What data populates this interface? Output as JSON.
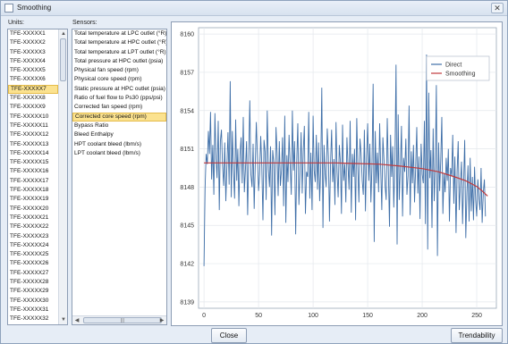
{
  "window": {
    "title": "Smoothing",
    "close_glyph": "✕"
  },
  "units": {
    "label": "Units:",
    "items": [
      "TFE-XXXXX1",
      "TFE-XXXXX2",
      "TFE-XXXXX3",
      "TFE-XXXXX4",
      "TFE-XXXXX5",
      "TFE-XXXXX6",
      "TFE-XXXXX7",
      "TFE-XXXXX8",
      "TFE-XXXXX9",
      "TFE-XXXXX10",
      "TFE-XXXXX11",
      "TFE-XXXXX12",
      "TFE-XXXXX13",
      "TFE-XXXXX14",
      "TFE-XXXXX15",
      "TFE-XXXXX16",
      "TFE-XXXXX17",
      "TFE-XXXXX18",
      "TFE-XXXXX19",
      "TFE-XXXXX20",
      "TFE-XXXXX21",
      "TFE-XXXXX22",
      "TFE-XXXXX23",
      "TFE-XXXXX24",
      "TFE-XXXXX25",
      "TFE-XXXXX26",
      "TFE-XXXXX27",
      "TFE-XXXXX28",
      "TFE-XXXXX29",
      "TFE-XXXXX30",
      "TFE-XXXXX31",
      "TFE-XXXXX32"
    ],
    "selected_index": 6
  },
  "sensors": {
    "label": "Sensors:",
    "items": [
      "Total temperature at LPC outlet (°R)",
      "Total temperature at HPC outlet (°R)",
      "Total temperature at LPT outlet (°R)",
      "Total pressure at HPC outlet (psia)",
      "Physical fan speed (rpm)",
      "Physical core speed (rpm)",
      "Static pressure at HPC outlet (psia)",
      "Ratio of fuel flow to Ps30 (pps/psi)",
      "Corrected fan speed (rpm)",
      "Corrected core speed (rpm)",
      "Bypass Ratio",
      "Bleed Enthalpy",
      "HPT coolant bleed (lbm/s)",
      "LPT coolant bleed (lbm/s)"
    ],
    "selected_index": 9
  },
  "buttons": {
    "close": "Close",
    "trendability": "Trendability"
  },
  "chart_data": {
    "type": "line",
    "xlim": [
      -5,
      268
    ],
    "ylim": [
      8138.5,
      8160.5
    ],
    "xticks": [
      0,
      50,
      100,
      150,
      200,
      250
    ],
    "yticks": [
      8139,
      8142,
      8145,
      8148,
      8151,
      8154,
      8157,
      8160
    ],
    "grid": true,
    "legend_position": "top-right",
    "series": [
      {
        "name": "Direct",
        "color": "#3f6fa8",
        "x_start": 0,
        "x_step": 1,
        "values": [
          8141.8,
          8147.9,
          8150.6,
          8149.8,
          8152.4,
          8150.6,
          8153.9,
          8148.6,
          8151.3,
          8147.4,
          8153.8,
          8150.3,
          8148.7,
          8153.2,
          8146.2,
          8151.6,
          8152.5,
          8149.7,
          8148.1,
          8151.5,
          8146.9,
          8149.6,
          8152.3,
          8148.2,
          8156.3,
          8147.2,
          8152.4,
          8149.4,
          8147.1,
          8153.3,
          8148.5,
          8151.0,
          8146.5,
          8150.6,
          8151.9,
          8148.3,
          8153.5,
          8147.6,
          8149.5,
          8151.6,
          8145.8,
          8150.4,
          8154.8,
          8149.0,
          8148.0,
          8151.4,
          8146.3,
          8149.8,
          8153.1,
          8150.2,
          8147.7,
          8149.0,
          8152.0,
          8149.7,
          8145.4,
          8151.7,
          8150.8,
          8147.0,
          8154.0,
          8149.4,
          8148.0,
          8151.2,
          8144.2,
          8150.9,
          8149.9,
          8145.8,
          8152.7,
          8150.7,
          8147.3,
          8151.6,
          8148.1,
          8149.3,
          8151.9,
          8146.5,
          8153.6,
          8145.2,
          8150.5,
          8148.4,
          8152.1,
          8149.6,
          8147.4,
          8154.0,
          8149.3,
          8151.6,
          8144.3,
          8150.1,
          8153.0,
          8146.6,
          8149.1,
          8152.3,
          8147.5,
          8150.8,
          8152.8,
          8145.9,
          8149.2,
          8148.8,
          8153.9,
          8147.1,
          8150.7,
          8146.2,
          8153.6,
          8149.3,
          8148.4,
          8152.1,
          8147.8,
          8151.5,
          8146.9,
          8149.5,
          8155.8,
          8144.8,
          8151.3,
          8149.1,
          8148.0,
          8152.6,
          8150.4,
          8145.3,
          8149.9,
          8152.5,
          8148.4,
          8150.2,
          8146.6,
          8153.1,
          8149.2,
          8147.2,
          8151.3,
          8150.0,
          8145.9,
          8152.9,
          8148.5,
          8149.8,
          8146.8,
          8151.9,
          8149.7,
          8147.8,
          8153.2,
          8146.0,
          8150.6,
          8148.8,
          8151.0,
          8145.4,
          8153.4,
          8149.6,
          8146.8,
          8151.8,
          8150.7,
          8148.5,
          8147.4,
          8152.5,
          8146.1,
          8150.3,
          8153.0,
          8148.5,
          8151.4,
          8146.8,
          8149.6,
          8156.1,
          8143.7,
          8152.4,
          8148.3,
          8150.7,
          8147.6,
          8153.0,
          8149.4,
          8146.2,
          8151.9,
          8150.1,
          8148.1,
          8147.0,
          8153.4,
          8149.4,
          8144.9,
          8152.1,
          8148.8,
          8151.2,
          8146.4,
          8150.1,
          8157.6,
          8143.5,
          8153.7,
          8147.0,
          8149.7,
          8152.8,
          8145.7,
          8150.3,
          8149.2,
          8151.8,
          8147.4,
          8148.9,
          8154.4,
          8145.8,
          8150.8,
          8148.3,
          8151.3,
          8146.8,
          8149.4,
          8152.7,
          8147.5,
          8150.4,
          8145.5,
          8151.4,
          8149.0,
          8148.3,
          8153.2,
          8145.1,
          8158.4,
          8143.1,
          8155.4,
          8148.7,
          8150.9,
          8144.8,
          8152.6,
          8146.9,
          8149.6,
          8156.0,
          8142.6,
          8151.5,
          8147.7,
          8150.1,
          8153.5,
          8145.9,
          8149.1,
          8147.6,
          8150.3,
          8148.5,
          8151.0,
          8145.3,
          8149.5,
          8148.9,
          8152.1,
          8146.7,
          8150.4,
          8144.4,
          8149.2,
          8151.6,
          8146.2,
          8148.1,
          8150.0,
          8145.1,
          8148.4,
          8151.7,
          8144.0,
          8147.6,
          8149.7,
          8145.3,
          8150.3,
          8146.1,
          8148.8,
          8145.4,
          8149.6,
          8147.0,
          8145.7,
          8148.6,
          8147.1,
          8146.2,
          8149.5,
          8145.2,
          8147.6,
          8148.6,
          8145.7
        ]
      },
      {
        "name": "Smoothing",
        "color": "#c0393b",
        "x": [
          0,
          40,
          80,
          120,
          140,
          160,
          180,
          200,
          215,
          230,
          240,
          250,
          255,
          260
        ],
        "values": [
          8149.9,
          8149.9,
          8149.9,
          8149.9,
          8149.85,
          8149.8,
          8149.65,
          8149.45,
          8149.2,
          8148.8,
          8148.5,
          8148.05,
          8147.7,
          8147.3
        ]
      }
    ]
  }
}
